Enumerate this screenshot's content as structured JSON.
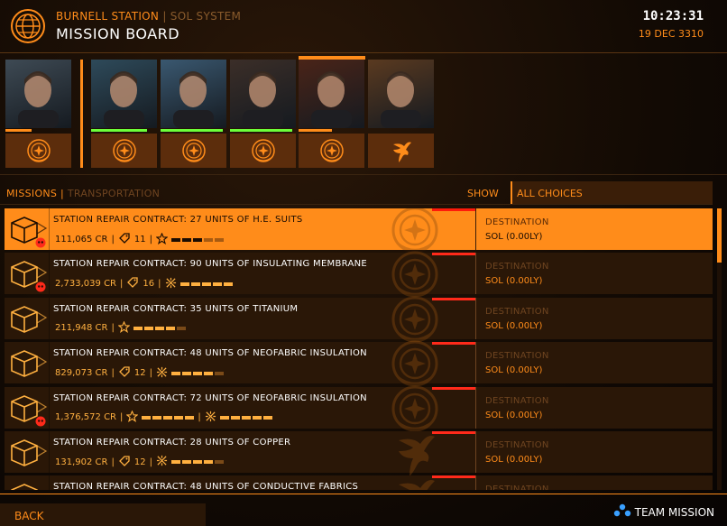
{
  "header": {
    "station": "BURNELL STATION",
    "separator": "|",
    "system": "SOL SYSTEM",
    "title": "MISSION BOARD",
    "time": "10:23:31",
    "date": "19 DEC 3310"
  },
  "portraits": [
    {
      "faction_icon": "federation-emblem-icon",
      "reputation": 0.4,
      "bar_color": "#ff8c1a"
    },
    {
      "faction_icon": "federation-emblem-icon",
      "reputation": 0.85,
      "bar_color": "#6cff3a"
    },
    {
      "faction_icon": "federation-emblem-icon",
      "reputation": 0.95,
      "bar_color": "#6cff3a"
    },
    {
      "faction_icon": "federation-emblem-icon",
      "reputation": 0.95,
      "bar_color": "#6cff3a"
    },
    {
      "faction_icon": "federation-emblem-icon",
      "reputation": 0.5,
      "bar_color": "#ff8c1a",
      "selected": true
    },
    {
      "faction_icon": "phoenix-emblem-icon",
      "reputation": 0.0,
      "bar_color": "#ff8c1a"
    }
  ],
  "tabs": {
    "missions": "MISSIONS",
    "separator": "|",
    "transportation": "TRANSPORTATION",
    "show": "SHOW",
    "filter": "ALL CHOICES"
  },
  "missions": [
    {
      "title": "STATION REPAIR CONTRACT: 27 UNITS OF H.E. SUITS",
      "reward": "111,065 CR",
      "tag_count": "11",
      "destination_label": "DESTINATION",
      "destination": "SOL (0.00LY)",
      "selected": true,
      "skull": true
    },
    {
      "title": "STATION REPAIR CONTRACT: 90 UNITS OF INSULATING MEMBRANE",
      "reward": "2,733,039 CR",
      "tag_count": "16",
      "destination_label": "DESTINATION",
      "destination": "SOL (0.00LY)",
      "skull": true
    },
    {
      "title": "STATION REPAIR CONTRACT: 35 UNITS OF TITANIUM",
      "reward": "211,948 CR",
      "destination_label": "DESTINATION",
      "destination": "SOL (0.00LY)"
    },
    {
      "title": "STATION REPAIR CONTRACT: 48 UNITS OF NEOFABRIC INSULATION",
      "reward": "829,073 CR",
      "tag_count": "12",
      "destination_label": "DESTINATION",
      "destination": "SOL (0.00LY)"
    },
    {
      "title": "STATION REPAIR CONTRACT: 72 UNITS OF NEOFABRIC INSULATION",
      "reward": "1,376,572 CR",
      "destination_label": "DESTINATION",
      "destination": "SOL (0.00LY)",
      "skull": true
    },
    {
      "title": "STATION REPAIR CONTRACT: 28 UNITS OF COPPER",
      "reward": "131,902 CR",
      "tag_count": "12",
      "destination_label": "DESTINATION",
      "destination": "SOL (0.00LY)"
    },
    {
      "title": "STATION REPAIR CONTRACT: 48 UNITS OF CONDUCTIVE FABRICS",
      "destination_label": "DESTINATION"
    }
  ],
  "footer": {
    "back": "BACK",
    "team_mission": "TEAM MISSION"
  },
  "colors": {
    "accent": "#ff8c1a",
    "background": "#0b0704",
    "alert": "#ff2a1a",
    "positive": "#6cff3a"
  }
}
